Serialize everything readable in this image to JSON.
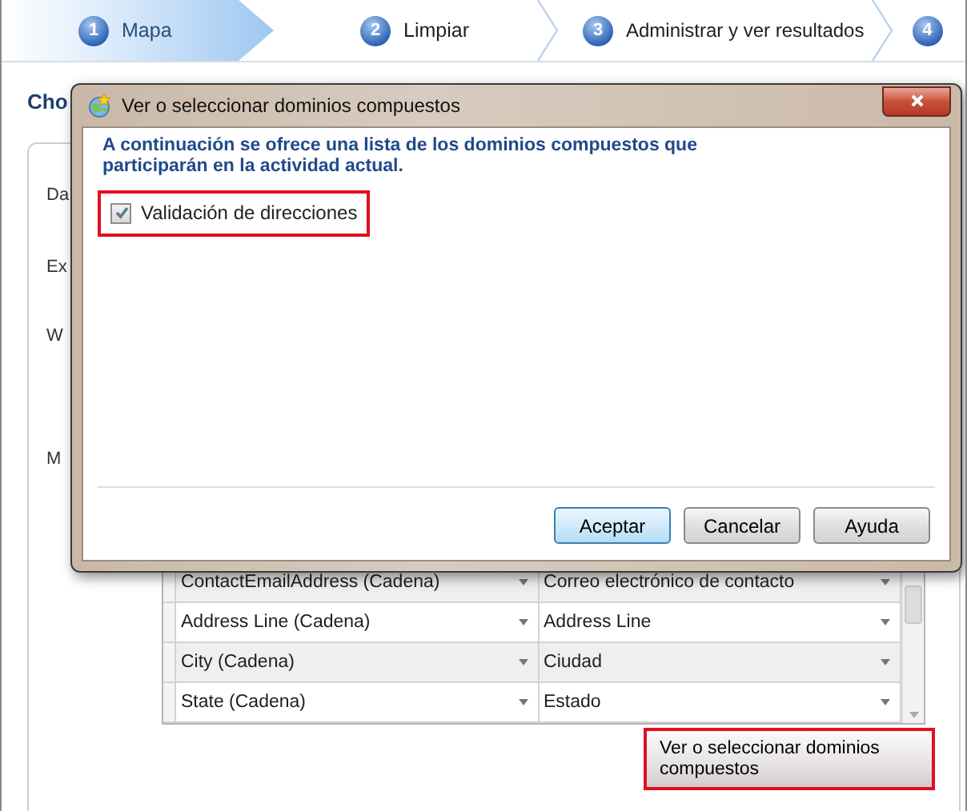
{
  "steps": [
    {
      "number": "1",
      "label": "Mapa",
      "selected": true
    },
    {
      "number": "2",
      "label": "Limpiar",
      "selected": false
    },
    {
      "number": "3",
      "label": "Administrar y ver resultados",
      "selected": false
    },
    {
      "number": "4",
      "selected": false
    }
  ],
  "page": {
    "title": "Cho",
    "labels": [
      "Da",
      "Ex",
      "W",
      "M"
    ]
  },
  "table": {
    "rows": [
      {
        "column_1": "ContactEmailAddress (Cadena)",
        "column_2": "Correo electrónico de contacto"
      },
      {
        "column_1": "Address Line (Cadena)",
        "column_2": "Address Line"
      },
      {
        "column_1": "City (Cadena)",
        "column_2": "Ciudad"
      },
      {
        "column_1": "State (Cadena)",
        "column_2": "Estado"
      }
    ]
  },
  "composite_button": {
    "label": "Ver o seleccionar dominios compuestos",
    "highlighted": true
  },
  "dialog": {
    "title": "Ver o seleccionar dominios compuestos",
    "intro": "A continuación se ofrece una lista de los dominios compuestos que participarán en la actividad actual.",
    "items": [
      {
        "label": "Validación de direcciones",
        "checked": true,
        "highlighted": true
      }
    ],
    "buttons": [
      {
        "label": "Aceptar",
        "default": true
      },
      {
        "label": "Cancelar",
        "default": false
      },
      {
        "label": "Ayuda",
        "default": false
      }
    ]
  }
}
